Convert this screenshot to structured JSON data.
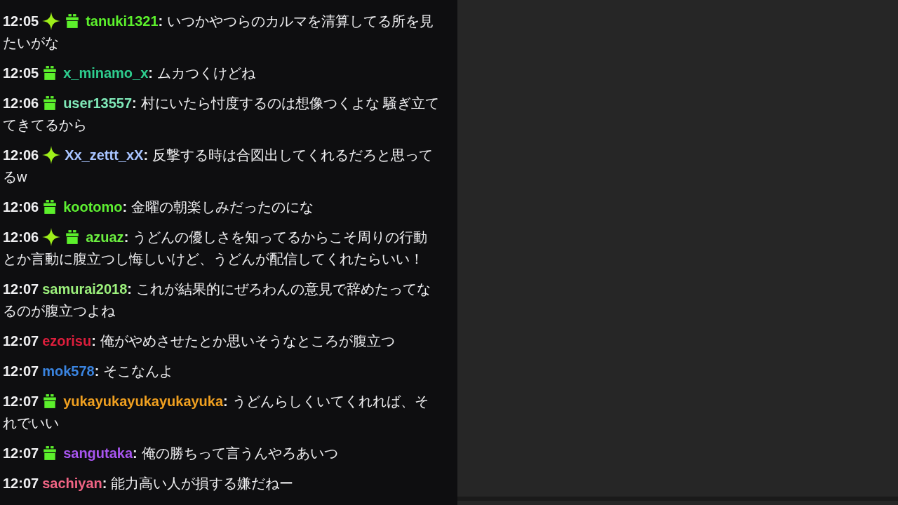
{
  "messages": [
    {
      "time": "12:05",
      "badges": [
        {
          "kind": "sparkle"
        },
        {
          "kind": "gift"
        }
      ],
      "user": "tanuki1321",
      "color": "#5cf02c",
      "sep": ":",
      "text": "いつかやつらのカルマを清算してる所を見たいがな"
    },
    {
      "time": "12:05",
      "badges": [
        {
          "kind": "gift"
        }
      ],
      "user": "x_minamo_x",
      "color": "#2ecc8e",
      "sep": ":",
      "text": "ムカつくけどね"
    },
    {
      "time": "12:06",
      "badges": [
        {
          "kind": "gift"
        }
      ],
      "user": "user13557",
      "color": "#7fe8b8",
      "sep": ":",
      "text": "村にいたら忖度するのは想像つくよな 騒ぎ立ててきてるから"
    },
    {
      "time": "12:06",
      "badges": [
        {
          "kind": "sparkle"
        }
      ],
      "user": "Xx_zettt_xX",
      "color": "#a8c4ff",
      "sep": ":",
      "text": "反撃する時は合図出してくれるだろと思ってるw"
    },
    {
      "time": "12:06",
      "badges": [
        {
          "kind": "gift"
        }
      ],
      "user": "kootomo",
      "color": "#5ef032",
      "sep": ":",
      "text": "金曜の朝楽しみだったのにな"
    },
    {
      "time": "12:06",
      "badges": [
        {
          "kind": "sparkle"
        },
        {
          "kind": "gift"
        }
      ],
      "user": "azuaz",
      "color": "#6cf040",
      "sep": ":",
      "text": "うどんの優しさを知ってるからこそ周りの行動とか言動に腹立つし悔しいけど、うどんが配信してくれたらいい！"
    },
    {
      "time": "12:07",
      "user": "samurai2018",
      "color": "#9cf07c",
      "sep": ":",
      "text": "これが結果的にぜろわんの意見で辞めたってなるのが腹立つよね"
    },
    {
      "time": "12:07",
      "user": "ezorisu",
      "color": "#dc1e3c",
      "sep": ":",
      "text": "俺がやめさせたとか思いそうなところが腹立つ"
    },
    {
      "time": "12:07",
      "user": "mok578",
      "color": "#3a84e0",
      "sep": ":",
      "text": "そこなんよ"
    },
    {
      "time": "12:07",
      "badges": [
        {
          "kind": "gift"
        }
      ],
      "user": "yukayukayukayukayuka",
      "color": "#f0a020",
      "sep": ":",
      "text": "うどんらしくいてくれれば、それでいい"
    },
    {
      "time": "12:07",
      "badges": [
        {
          "kind": "gift"
        }
      ],
      "user": "sangutaka",
      "color": "#a855f0",
      "sep": ":",
      "text": "俺の勝ちって言うんやろあいつ"
    },
    {
      "time": "12:07",
      "user": "sachiyan",
      "color": "#f06484",
      "sep": ":",
      "text": "能力高い人が損する嫌だねー"
    }
  ]
}
